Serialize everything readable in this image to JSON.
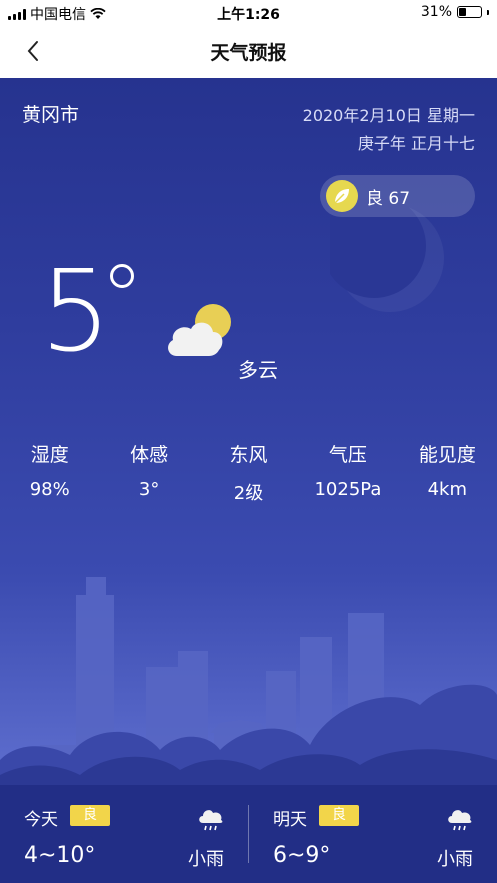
{
  "status_bar": {
    "carrier": "中国电信",
    "time": "上午1:26",
    "battery": "31%"
  },
  "nav": {
    "title": "天气预报"
  },
  "location": {
    "city": "黄冈市"
  },
  "date": {
    "gregorian": "2020年2月10日  星期一",
    "lunar": "庚子年  正月十七"
  },
  "aqi": {
    "label": "良 67"
  },
  "current": {
    "temperature": "5",
    "condition": "多云"
  },
  "stats": [
    {
      "label": "湿度",
      "value": "98%"
    },
    {
      "label": "体感",
      "value": "3°"
    },
    {
      "label": "东风",
      "value": "2级"
    },
    {
      "label": "气压",
      "value": "1025Pa"
    },
    {
      "label": "能见度",
      "value": "4km"
    }
  ],
  "forecast": [
    {
      "day": "今天",
      "quality": "良",
      "range": "4~10°",
      "condition": "小雨"
    },
    {
      "day": "明天",
      "quality": "良",
      "range": "6~9°",
      "condition": "小雨"
    }
  ],
  "colors": {
    "background_top": "#26338f",
    "background_bottom": "#5f6fcf",
    "forecast_bar": "#222e86",
    "badge": "#f2d54a"
  }
}
